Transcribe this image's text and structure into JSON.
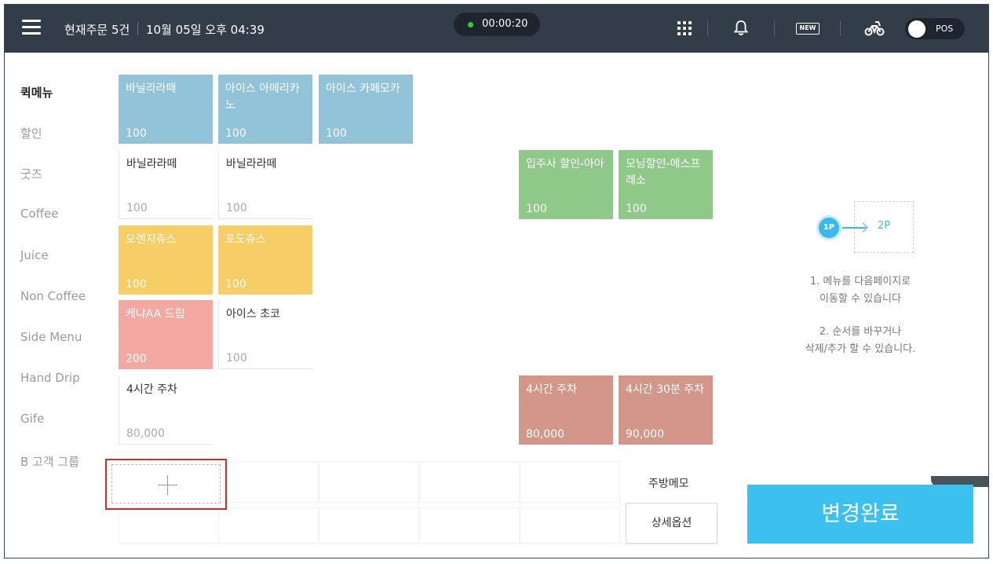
{
  "header": {
    "current_orders": "현재주문 5건",
    "datetime": "10월 05일 오후 04:39",
    "timer": "00:00:20",
    "new_badge": "NEW",
    "pos_label": "POS"
  },
  "categories": [
    "퀵메뉴",
    "할인",
    "굿즈",
    "Coffee",
    "Juice",
    "Non Coffee",
    "Side Menu",
    "Hand Drip",
    "Gife",
    "B 고객 그룹"
  ],
  "tiles": [
    {
      "name": "바닐라라떼",
      "price": "100",
      "color": "#91c4d8"
    },
    {
      "name": "아이스 아메리카노",
      "price": "100",
      "color": "#91c4d8"
    },
    {
      "name": "아이스 카페모카",
      "price": "100",
      "color": "#91c4d8"
    },
    {
      "name": "바닐라라떼",
      "price": "100"
    },
    {
      "name": "바닐라라떼",
      "price": "100"
    },
    {
      "name": "입주사 할인-아아",
      "price": "100",
      "color": "#8ec989"
    },
    {
      "name": "모닝할인-에스프레소",
      "price": "100",
      "color": "#8ec989"
    },
    {
      "name": "오렌지쥬스",
      "price": "100",
      "color": "#f7cd66"
    },
    {
      "name": "포도쥬스",
      "price": "100",
      "color": "#f7cd66"
    },
    {
      "name": "케냐AA 드립",
      "price": "200",
      "color": "#f4a8a2"
    },
    {
      "name": "아이스 초코",
      "price": "100"
    },
    {
      "name": "4시간 주차",
      "price": "80,000"
    },
    {
      "name": "4시간 주차",
      "price": "80,000",
      "color": "#d3968a"
    },
    {
      "name": "4시간 30분 주차",
      "price": "90,000",
      "color": "#d3968a"
    }
  ],
  "guide": {
    "page1": "1P",
    "page2": "2P",
    "line1a": "1. 메뉴를 다음페이지로",
    "line1b": "이동할 수 있습니다",
    "line2a": "2. 순서를 바꾸거나",
    "line2b": "삭제/추가 할 수 있습니다."
  },
  "buttons": {
    "kitchen_memo": "주방메모",
    "detail_option": "상세옵션",
    "complete": "변경완료"
  }
}
